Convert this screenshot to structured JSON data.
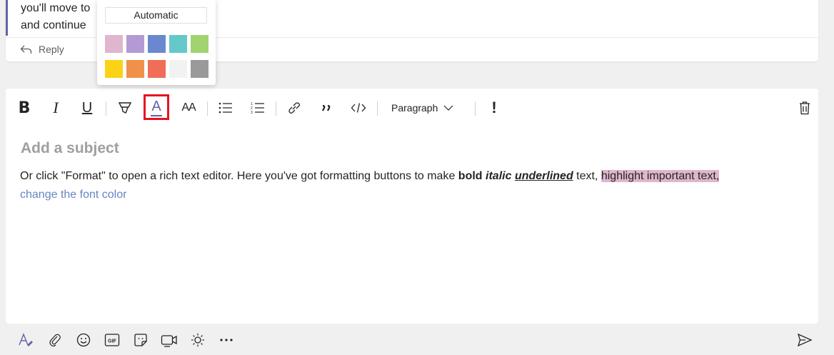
{
  "previous_message": {
    "line1": "you'll move to",
    "line2": "and continue",
    "reply_label": "Reply"
  },
  "color_picker": {
    "automatic_label": "Automatic",
    "swatches_row1": [
      "#dfb6cd",
      "#b39ad4",
      "#6a88cf",
      "#65c8cb",
      "#a1d36e"
    ],
    "swatches_row2": [
      "#fbd216",
      "#f0914a",
      "#f06d58",
      "#f2f2f2",
      "#9a9a9a"
    ]
  },
  "toolbar": {
    "bold_label": "B",
    "italic_label": "I",
    "underline_label": "U",
    "font_color_label": "A",
    "font_size_label": "AA",
    "paragraph_label": "Paragraph",
    "important_label": "!",
    "accent_color": "#6264a7",
    "selected_outline_color": "#e81123"
  },
  "editor": {
    "subject_placeholder": "Add a subject",
    "text_plain_1": "Or click \"Format\" to open a rich text editor. Here you've got formatting buttons to make ",
    "text_bold": "bold",
    "text_italic": "italic",
    "text_underlined": "underlined",
    "text_plain_2": " text, ",
    "text_highlight": "highlight important text,",
    "text_colored": "change the font color"
  },
  "bottom_bar": {
    "icons": [
      "format-icon",
      "attach-icon",
      "emoji-icon",
      "gif-icon",
      "sticker-icon",
      "meet-now-icon",
      "praise-icon",
      "more-options-icon",
      "send-icon"
    ]
  }
}
